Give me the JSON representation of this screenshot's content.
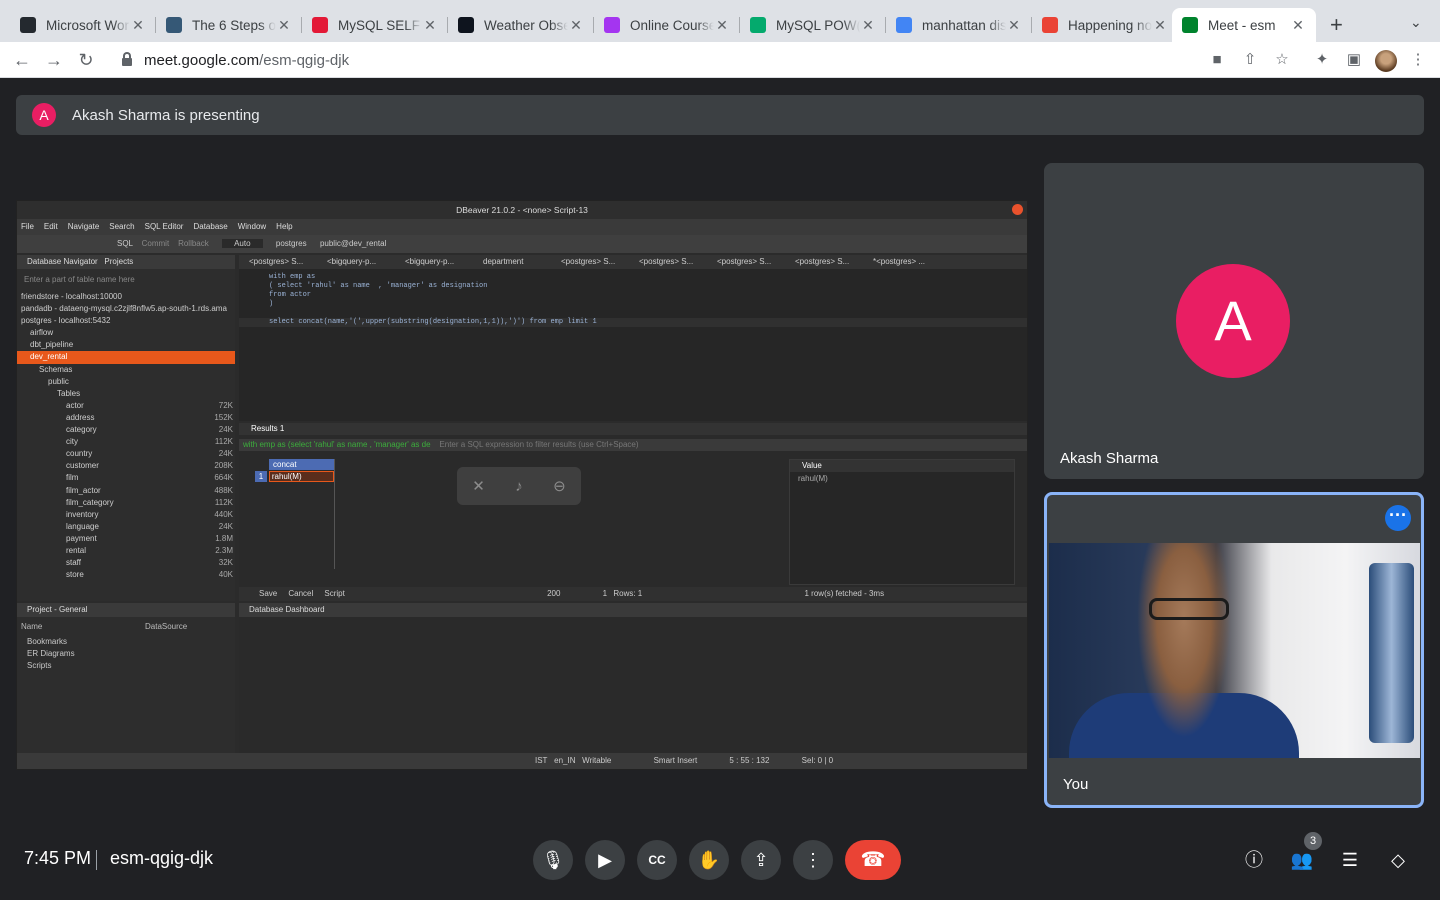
{
  "browser": {
    "tabs": [
      {
        "title": "Microsoft Wor",
        "favicon": "github-icon",
        "color": "#24292f"
      },
      {
        "title": "The 6 Steps o",
        "favicon": "tds-icon",
        "color": "#355876"
      },
      {
        "title": "MySQL SELF J",
        "favicon": "tesla-icon",
        "color": "#e31937"
      },
      {
        "title": "Weather Obse",
        "favicon": "hackerrank-icon",
        "color": "#0e141e"
      },
      {
        "title": "Online Course",
        "favicon": "udemy-icon",
        "color": "#a435f0"
      },
      {
        "title": "MySQL POW()",
        "favicon": "w3schools-icon",
        "color": "#04aa6d"
      },
      {
        "title": "manhattan dis",
        "favicon": "google-icon",
        "color": "#4285f4"
      },
      {
        "title": "Happening no",
        "favicon": "gmail-icon",
        "color": "#ea4335"
      },
      {
        "title": "Meet - esm",
        "favicon": "meet-icon",
        "color": "#00832d"
      }
    ],
    "url_host": "meet.google.com",
    "url_path": "/esm-qgig-djk"
  },
  "meet": {
    "presenting_initial": "A",
    "presenting_text": "Akash Sharma is presenting",
    "participants": [
      {
        "name": "Akash Sharma",
        "initial": "A"
      },
      {
        "name": "You"
      }
    ],
    "time": "7:45 PM",
    "meeting_code": "esm-qgig-djk",
    "people_count": "3"
  },
  "shared_screen": {
    "window_title": "DBeaver 21.0.2 - <none> Script-13",
    "menu": [
      "File",
      "Edit",
      "Navigate",
      "Search",
      "SQL Editor",
      "Database",
      "Window",
      "Help"
    ],
    "toolbar": {
      "sql": "SQL",
      "commit": "Commit",
      "rollback": "Rollback",
      "mode": "Auto",
      "db": "postgres",
      "schema": "public@dev_rental"
    },
    "navigator_title": "Database Navigator",
    "projects_tab": "Projects",
    "filter_placeholder": "Enter a part of table name here",
    "tree": [
      {
        "label": "friendstore - localhost:10000",
        "indent": 0
      },
      {
        "label": "pandadb - dataeng-mysql.c2zjlf8nflw5.ap-south-1.rds.ama",
        "indent": 0
      },
      {
        "label": "postgres - localhost:5432",
        "indent": 0
      },
      {
        "label": "airflow",
        "indent": 1
      },
      {
        "label": "dbt_pipeline",
        "indent": 1
      },
      {
        "label": "dev_rental",
        "indent": 1,
        "selected": true
      },
      {
        "label": "Schemas",
        "indent": 2
      },
      {
        "label": "public",
        "indent": 3
      },
      {
        "label": "Tables",
        "indent": 4
      },
      {
        "label": "actor",
        "indent": 5,
        "size": "72K"
      },
      {
        "label": "address",
        "indent": 5,
        "size": "152K"
      },
      {
        "label": "category",
        "indent": 5,
        "size": "24K"
      },
      {
        "label": "city",
        "indent": 5,
        "size": "112K"
      },
      {
        "label": "country",
        "indent": 5,
        "size": "24K"
      },
      {
        "label": "customer",
        "indent": 5,
        "size": "208K"
      },
      {
        "label": "film",
        "indent": 5,
        "size": "664K"
      },
      {
        "label": "film_actor",
        "indent": 5,
        "size": "488K"
      },
      {
        "label": "film_category",
        "indent": 5,
        "size": "112K"
      },
      {
        "label": "inventory",
        "indent": 5,
        "size": "440K"
      },
      {
        "label": "language",
        "indent": 5,
        "size": "24K"
      },
      {
        "label": "payment",
        "indent": 5,
        "size": "1.8M"
      },
      {
        "label": "rental",
        "indent": 5,
        "size": "2.3M"
      },
      {
        "label": "staff",
        "indent": 5,
        "size": "32K"
      },
      {
        "label": "store",
        "indent": 5,
        "size": "40K"
      }
    ],
    "editor_tabs": [
      "<postgres> S...",
      "<bigquery-p...",
      "<bigquery-p...",
      "department",
      "<postgres> S...",
      "<postgres> S...",
      "<postgres> S...",
      "<postgres> S...",
      "*<postgres> ..."
    ],
    "code": [
      "with emp as",
      "( select 'rahul' as name  , 'manager' as designation",
      "from actor",
      ")",
      "select concat(name,'(',upper(substring(designation,1,1)),')') from emp limit 1"
    ],
    "results_tab": "Results 1",
    "results_filter": "with emp as (select 'rahul' as name , 'manager' as de",
    "results_filter_hint": "Enter a SQL expression to filter results (use Ctrl+Space)",
    "column": "concat",
    "row_num": "1",
    "cell_value": "rahul(M)",
    "value_panel_title": "Value",
    "value_panel_content": "rahul(M)",
    "results_status": {
      "save": "Save",
      "cancel": "Cancel",
      "script": "Script",
      "limit": "200",
      "rows": "1",
      "rows_label": "Rows: 1",
      "fetched": "1 row(s) fetched - 3ms"
    },
    "project_title": "Project - General",
    "project_cols": [
      "Name",
      "DataSource"
    ],
    "project_items": [
      "Bookmarks",
      "ER Diagrams",
      "Scripts"
    ],
    "dashboard_title": "Database Dashboard",
    "statusbar": {
      "tz": "IST",
      "locale": "en_IN",
      "mode": "Writable",
      "insert": "Smart Insert",
      "pos": "5 : 55 : 132",
      "sel": "Sel: 0 | 0"
    }
  }
}
